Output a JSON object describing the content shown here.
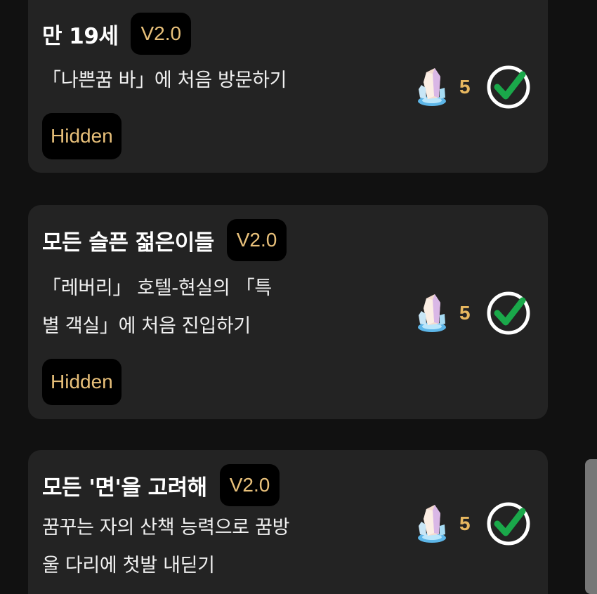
{
  "achievements": [
    {
      "title": "만 19세",
      "version": "V2.0",
      "description": [
        "「나쁜꿈 바」에 처음 방문하기"
      ],
      "tag": "Hidden",
      "reward_count": "5",
      "completed": true
    },
    {
      "title": "모든 슬픈 젊은이들",
      "version": "V2.0",
      "description": [
        "「레버리」 호텔-현실의 「특",
        "별 객실」에 처음 진입하기"
      ],
      "tag": "Hidden",
      "reward_count": "5",
      "completed": true
    },
    {
      "title": "모든 '면'을 고려해",
      "version": "V2.0",
      "description": [
        "꿈꾸는 자의 산책 능력으로 꿈방",
        "울 다리에 첫발 내딛기"
      ],
      "reward_count": "5",
      "completed": true
    }
  ],
  "icons": {
    "reward": "crystal-icon",
    "status": "check-circle-icon"
  },
  "colors": {
    "background": "#111111",
    "card": "#232323",
    "accent_gold": "#e8c07a",
    "check_green": "#1aa84a"
  }
}
